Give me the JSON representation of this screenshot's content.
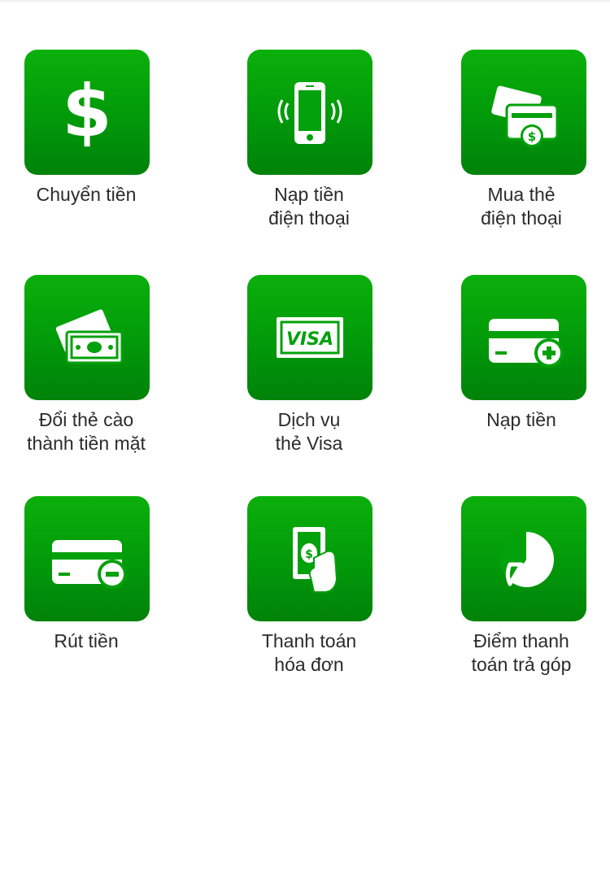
{
  "colors": {
    "tile_top": "#0bb00b",
    "tile_bottom": "#008209",
    "label": "#2b2b2b",
    "background": "#ffffff"
  },
  "grid": {
    "items": [
      {
        "icon": "dollar-icon",
        "line1": "Chuyển tiền",
        "line2": ""
      },
      {
        "icon": "phone-vibrate-icon",
        "line1": "Nạp tiền",
        "line2": "điện thoại"
      },
      {
        "icon": "buy-card-icon",
        "line1": "Mua thẻ",
        "line2": "điện thoại"
      },
      {
        "icon": "cash-exchange-icon",
        "line1": "Đổi thẻ cào",
        "line2": "thành tiền mặt"
      },
      {
        "icon": "visa-icon",
        "line1": "Dịch vụ",
        "line2": "thẻ Visa"
      },
      {
        "icon": "card-plus-icon",
        "line1": "Nạp tiền",
        "line2": ""
      },
      {
        "icon": "card-minus-icon",
        "line1": "Rút tiền",
        "line2": ""
      },
      {
        "icon": "bill-payment-icon",
        "line1": "Thanh toán",
        "line2": "hóa đơn"
      },
      {
        "icon": "pie-chart-icon",
        "line1": "Điểm thanh",
        "line2": "toán trả góp"
      }
    ]
  }
}
